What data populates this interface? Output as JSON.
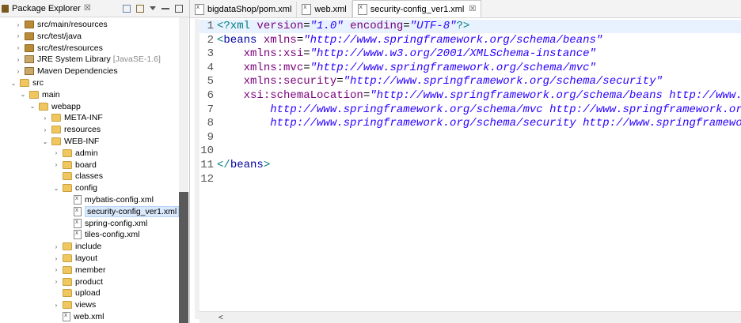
{
  "explorer": {
    "title": "Package Explorer",
    "close": "☒",
    "rows": [
      {
        "label": "src/main/resources",
        "toggle": "›",
        "icon": "package-folder-icon"
      },
      {
        "label": "src/test/java",
        "toggle": "›",
        "icon": "package-folder-icon"
      },
      {
        "label": "src/test/resources",
        "toggle": "›",
        "icon": "package-folder-icon"
      },
      {
        "label": "JRE System Library",
        "suffix": "[JavaSE-1.6]",
        "toggle": "›",
        "icon": "library-icon"
      },
      {
        "label": "Maven Dependencies",
        "toggle": "›",
        "icon": "library-icon"
      },
      {
        "label": "src",
        "toggle": "⌄",
        "icon": "folder-icon"
      },
      {
        "label": "main",
        "toggle": "⌄",
        "icon": "folder-icon"
      },
      {
        "label": "webapp",
        "toggle": "⌄",
        "icon": "folder-icon"
      },
      {
        "label": "META-INF",
        "toggle": "›",
        "icon": "folder-icon"
      },
      {
        "label": "resources",
        "toggle": "›",
        "icon": "folder-icon"
      },
      {
        "label": "WEB-INF",
        "toggle": "⌄",
        "icon": "folder-icon"
      },
      {
        "label": "admin",
        "toggle": "›",
        "icon": "folder-icon"
      },
      {
        "label": "board",
        "toggle": "›",
        "icon": "folder-icon"
      },
      {
        "label": "classes",
        "toggle": "",
        "icon": "folder-icon"
      },
      {
        "label": "config",
        "toggle": "⌄",
        "icon": "folder-icon"
      },
      {
        "label": "mybatis-config.xml",
        "toggle": "",
        "icon": "xml-file-icon"
      },
      {
        "label": "security-config_ver1.xml",
        "toggle": "",
        "icon": "xml-file-icon",
        "selected": true
      },
      {
        "label": "spring-config.xml",
        "toggle": "",
        "icon": "xml-file-icon"
      },
      {
        "label": "tiles-config.xml",
        "toggle": "",
        "icon": "xml-file-icon"
      },
      {
        "label": "include",
        "toggle": "›",
        "icon": "folder-icon"
      },
      {
        "label": "layout",
        "toggle": "›",
        "icon": "folder-icon"
      },
      {
        "label": "member",
        "toggle": "›",
        "icon": "folder-icon"
      },
      {
        "label": "product",
        "toggle": "›",
        "icon": "folder-icon"
      },
      {
        "label": "upload",
        "toggle": "",
        "icon": "folder-icon"
      },
      {
        "label": "views",
        "toggle": "›",
        "icon": "folder-icon"
      },
      {
        "label": "web.xml",
        "toggle": "",
        "icon": "xml-file-icon"
      }
    ]
  },
  "editor": {
    "tabs": [
      {
        "label": "bigdataShop/pom.xml",
        "active": false
      },
      {
        "label": "web.xml",
        "active": false
      },
      {
        "label": "security-config_ver1.xml",
        "active": true,
        "close": "☒"
      }
    ],
    "lines": [
      {
        "n": "1",
        "tokens": [
          [
            "pi",
            "<?xml "
          ],
          [
            "attr",
            "version"
          ],
          [
            "txt",
            "="
          ],
          [
            "val",
            "\"1.0\""
          ],
          [
            "txt",
            " "
          ],
          [
            "attr",
            "encoding"
          ],
          [
            "txt",
            "="
          ],
          [
            "val",
            "\"UTF-8\""
          ],
          [
            "pi",
            "?>"
          ]
        ]
      },
      {
        "n": "2",
        "tokens": [
          [
            "brk",
            "<"
          ],
          [
            "tag",
            "beans "
          ],
          [
            "attr",
            "xmlns"
          ],
          [
            "txt",
            "="
          ],
          [
            "val",
            "\"http://www.springframework.org/schema/beans\""
          ]
        ]
      },
      {
        "n": "3",
        "tokens": [
          [
            "txt",
            "    "
          ],
          [
            "attr",
            "xmlns:xsi"
          ],
          [
            "txt",
            "="
          ],
          [
            "val",
            "\"http://www.w3.org/2001/XMLSchema-instance\""
          ]
        ]
      },
      {
        "n": "4",
        "tokens": [
          [
            "txt",
            "    "
          ],
          [
            "attr",
            "xmlns:mvc"
          ],
          [
            "txt",
            "="
          ],
          [
            "val",
            "\"http://www.springframework.org/schema/mvc\""
          ]
        ]
      },
      {
        "n": "5",
        "tokens": [
          [
            "txt",
            "    "
          ],
          [
            "attr",
            "xmlns:security"
          ],
          [
            "txt",
            "="
          ],
          [
            "val",
            "\"http://www.springframework.org/schema/security\""
          ]
        ]
      },
      {
        "n": "6",
        "tokens": [
          [
            "txt",
            "    "
          ],
          [
            "attr",
            "xsi:schemaLocation"
          ],
          [
            "txt",
            "="
          ],
          [
            "val",
            "\"http://www.springframework.org/schema/beans http://www."
          ]
        ]
      },
      {
        "n": "7",
        "tokens": [
          [
            "txt",
            "        "
          ],
          [
            "val",
            "http://www.springframework.org/schema/mvc http://www.springframework.or"
          ]
        ]
      },
      {
        "n": "8",
        "tokens": [
          [
            "txt",
            "        "
          ],
          [
            "val",
            "http://www.springframework.org/schema/security http://www.springframewo"
          ]
        ]
      },
      {
        "n": "9",
        "tokens": []
      },
      {
        "n": "10",
        "tokens": []
      },
      {
        "n": "11",
        "tokens": [
          [
            "brk",
            "</"
          ],
          [
            "tag",
            "beans"
          ],
          [
            "brk",
            ">"
          ]
        ]
      },
      {
        "n": "12",
        "tokens": []
      }
    ],
    "scroll_left_arrow": "<"
  },
  "colors": {
    "tag": "#0000a0",
    "attribute": "#7a007a",
    "value": "#2a00ff",
    "processing_instruction": "#008080",
    "selection": "#d9e8fb",
    "current_line": "#e8f2fe"
  }
}
